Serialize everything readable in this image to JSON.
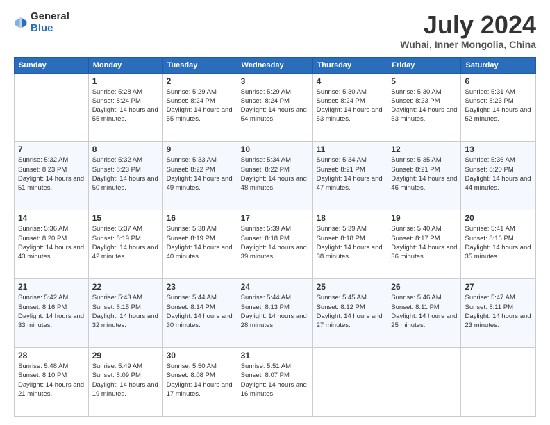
{
  "logo": {
    "general": "General",
    "blue": "Blue"
  },
  "title": "July 2024",
  "location": "Wuhai, Inner Mongolia, China",
  "weekdays": [
    "Sunday",
    "Monday",
    "Tuesday",
    "Wednesday",
    "Thursday",
    "Friday",
    "Saturday"
  ],
  "weeks": [
    [
      {
        "day": null,
        "sunrise": null,
        "sunset": null,
        "daylight": null
      },
      {
        "day": "1",
        "sunrise": "5:28 AM",
        "sunset": "8:24 PM",
        "daylight": "14 hours and 55 minutes."
      },
      {
        "day": "2",
        "sunrise": "5:29 AM",
        "sunset": "8:24 PM",
        "daylight": "14 hours and 55 minutes."
      },
      {
        "day": "3",
        "sunrise": "5:29 AM",
        "sunset": "8:24 PM",
        "daylight": "14 hours and 54 minutes."
      },
      {
        "day": "4",
        "sunrise": "5:30 AM",
        "sunset": "8:24 PM",
        "daylight": "14 hours and 53 minutes."
      },
      {
        "day": "5",
        "sunrise": "5:30 AM",
        "sunset": "8:23 PM",
        "daylight": "14 hours and 53 minutes."
      },
      {
        "day": "6",
        "sunrise": "5:31 AM",
        "sunset": "8:23 PM",
        "daylight": "14 hours and 52 minutes."
      }
    ],
    [
      {
        "day": "7",
        "sunrise": "5:32 AM",
        "sunset": "8:23 PM",
        "daylight": "14 hours and 51 minutes."
      },
      {
        "day": "8",
        "sunrise": "5:32 AM",
        "sunset": "8:23 PM",
        "daylight": "14 hours and 50 minutes."
      },
      {
        "day": "9",
        "sunrise": "5:33 AM",
        "sunset": "8:22 PM",
        "daylight": "14 hours and 49 minutes."
      },
      {
        "day": "10",
        "sunrise": "5:34 AM",
        "sunset": "8:22 PM",
        "daylight": "14 hours and 48 minutes."
      },
      {
        "day": "11",
        "sunrise": "5:34 AM",
        "sunset": "8:21 PM",
        "daylight": "14 hours and 47 minutes."
      },
      {
        "day": "12",
        "sunrise": "5:35 AM",
        "sunset": "8:21 PM",
        "daylight": "14 hours and 46 minutes."
      },
      {
        "day": "13",
        "sunrise": "5:36 AM",
        "sunset": "8:20 PM",
        "daylight": "14 hours and 44 minutes."
      }
    ],
    [
      {
        "day": "14",
        "sunrise": "5:36 AM",
        "sunset": "8:20 PM",
        "daylight": "14 hours and 43 minutes."
      },
      {
        "day": "15",
        "sunrise": "5:37 AM",
        "sunset": "8:19 PM",
        "daylight": "14 hours and 42 minutes."
      },
      {
        "day": "16",
        "sunrise": "5:38 AM",
        "sunset": "8:19 PM",
        "daylight": "14 hours and 40 minutes."
      },
      {
        "day": "17",
        "sunrise": "5:39 AM",
        "sunset": "8:18 PM",
        "daylight": "14 hours and 39 minutes."
      },
      {
        "day": "18",
        "sunrise": "5:39 AM",
        "sunset": "8:18 PM",
        "daylight": "14 hours and 38 minutes."
      },
      {
        "day": "19",
        "sunrise": "5:40 AM",
        "sunset": "8:17 PM",
        "daylight": "14 hours and 36 minutes."
      },
      {
        "day": "20",
        "sunrise": "5:41 AM",
        "sunset": "8:16 PM",
        "daylight": "14 hours and 35 minutes."
      }
    ],
    [
      {
        "day": "21",
        "sunrise": "5:42 AM",
        "sunset": "8:16 PM",
        "daylight": "14 hours and 33 minutes."
      },
      {
        "day": "22",
        "sunrise": "5:43 AM",
        "sunset": "8:15 PM",
        "daylight": "14 hours and 32 minutes."
      },
      {
        "day": "23",
        "sunrise": "5:44 AM",
        "sunset": "8:14 PM",
        "daylight": "14 hours and 30 minutes."
      },
      {
        "day": "24",
        "sunrise": "5:44 AM",
        "sunset": "8:13 PM",
        "daylight": "14 hours and 28 minutes."
      },
      {
        "day": "25",
        "sunrise": "5:45 AM",
        "sunset": "8:12 PM",
        "daylight": "14 hours and 27 minutes."
      },
      {
        "day": "26",
        "sunrise": "5:46 AM",
        "sunset": "8:11 PM",
        "daylight": "14 hours and 25 minutes."
      },
      {
        "day": "27",
        "sunrise": "5:47 AM",
        "sunset": "8:11 PM",
        "daylight": "14 hours and 23 minutes."
      }
    ],
    [
      {
        "day": "28",
        "sunrise": "5:48 AM",
        "sunset": "8:10 PM",
        "daylight": "14 hours and 21 minutes."
      },
      {
        "day": "29",
        "sunrise": "5:49 AM",
        "sunset": "8:09 PM",
        "daylight": "14 hours and 19 minutes."
      },
      {
        "day": "30",
        "sunrise": "5:50 AM",
        "sunset": "8:08 PM",
        "daylight": "14 hours and 17 minutes."
      },
      {
        "day": "31",
        "sunrise": "5:51 AM",
        "sunset": "8:07 PM",
        "daylight": "14 hours and 16 minutes."
      },
      {
        "day": null,
        "sunrise": null,
        "sunset": null,
        "daylight": null
      },
      {
        "day": null,
        "sunrise": null,
        "sunset": null,
        "daylight": null
      },
      {
        "day": null,
        "sunrise": null,
        "sunset": null,
        "daylight": null
      }
    ]
  ],
  "labels": {
    "sunrise_prefix": "Sunrise: ",
    "sunset_prefix": "Sunset: ",
    "daylight_prefix": "Daylight: "
  }
}
